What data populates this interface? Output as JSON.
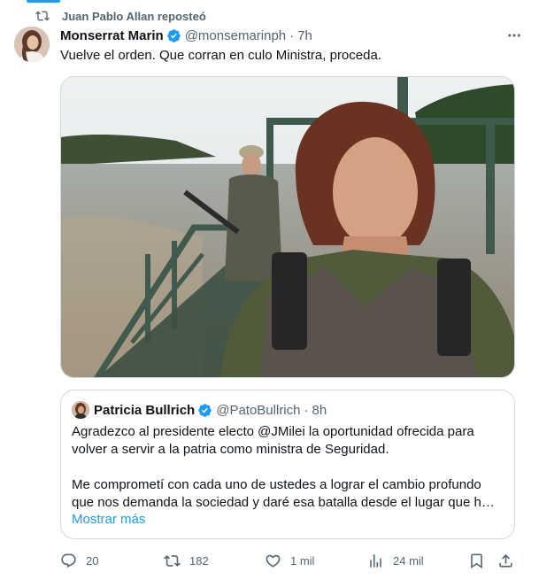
{
  "repost": {
    "label": "Juan Pablo Allan reposteó"
  },
  "tweet": {
    "author_name": "Monserrat Marin",
    "handle": "@monsemarinph",
    "separator": "·",
    "time": "7h",
    "text": "Vuelve el orden. Que corran en culo Ministra, proceda."
  },
  "quote": {
    "author_name": "Patricia Bullrich",
    "handle": "@PatoBullrich",
    "separator": "·",
    "time": "8h",
    "paragraph1_line1": "Agradezco al presidente electo @JMilei la oportunidad ofrecida para",
    "paragraph1_line2": "volver a servir a la patria como ministra de Seguridad.",
    "paragraph2_line1": "Me comprometí con cada uno de ustedes a lograr el cambio profundo",
    "paragraph2_line2": "que nos demanda la sociedad y daré esa batalla desde el lugar que h…",
    "show_more": "Mostrar más"
  },
  "actions": {
    "replies": "20",
    "reposts": "182",
    "likes": "1 mil",
    "views": "24 mil"
  },
  "colors": {
    "accent": "#1d9bf0",
    "muted": "#536471",
    "repost_green": "#00ba7c"
  }
}
